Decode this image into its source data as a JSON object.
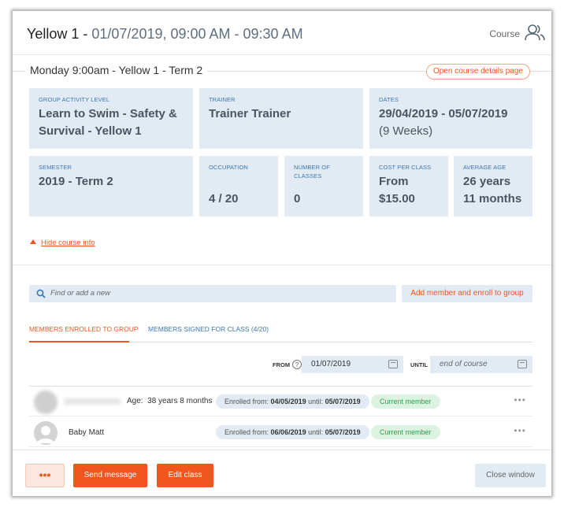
{
  "header": {
    "title": "Yellow 1 - ",
    "datetime": "01/07/2019, 09:00 AM - 09:30 AM",
    "course_label": "Course",
    "course_icon": "people-icon"
  },
  "section": {
    "title": "Monday 9:00am - Yellow 1 - Term 2",
    "open_course_label": "Open course details page"
  },
  "info": {
    "group_level": {
      "label": "Group activity level",
      "line1": "Learn to Swim - Safety &",
      "line2": "Survival - Yellow 1"
    },
    "trainer": {
      "label": "Trainer",
      "value": "Trainer Trainer"
    },
    "dates": {
      "label": "Dates",
      "value": "29/04/2019 - 05/07/2019",
      "sub": "(9 Weeks)"
    },
    "semester": {
      "label": "Semester",
      "value": "2019 - Term 2"
    },
    "occupation": {
      "label": "Occupation",
      "value": "4 / 20"
    },
    "num_classes": {
      "label_line1": "Number of",
      "label_line2": "classes",
      "value": "0"
    },
    "cost": {
      "label": "Cost per class",
      "line1": "From",
      "line2": "$15.00"
    },
    "avg_age": {
      "label": "Average age",
      "line1": "26 years",
      "line2": "11 months"
    }
  },
  "hide_info_label": "Hide course info",
  "search": {
    "placeholder": "Find or add a new",
    "add_button": "Add member and enroll to group"
  },
  "tabs": [
    {
      "label": "Members enrolled to group",
      "active": true
    },
    {
      "label": "Members signed for class (4/20)",
      "active": false
    }
  ],
  "filters": {
    "from_label": "FROM",
    "from_value": "01/07/2019",
    "until_label": "UNTIL",
    "until_placeholder": "end of course"
  },
  "members": [
    {
      "name": "",
      "age_label": "Age:",
      "age_value": "38 years 8 months",
      "enrolled_prefix": "Enrolled from:",
      "enrolled_from": "04/05/2019",
      "until_prefix": "until:",
      "enrolled_until": "05/07/2019",
      "status": "Current member"
    },
    {
      "name": "Baby Matt",
      "enrolled_prefix": "Enrolled from:",
      "enrolled_from": "06/06/2019",
      "until_prefix": "until:",
      "enrolled_until": "05/07/2019",
      "status": "Current member"
    }
  ],
  "footer": {
    "more_label": "•••",
    "send_message": "Send message",
    "edit_class": "Edit class",
    "close_window": "Close window"
  },
  "colors": {
    "accent": "#f0561d",
    "card_bg": "#e2ebf3",
    "label_blue": "#3a78b3",
    "status_green": "#2e9e4e"
  }
}
